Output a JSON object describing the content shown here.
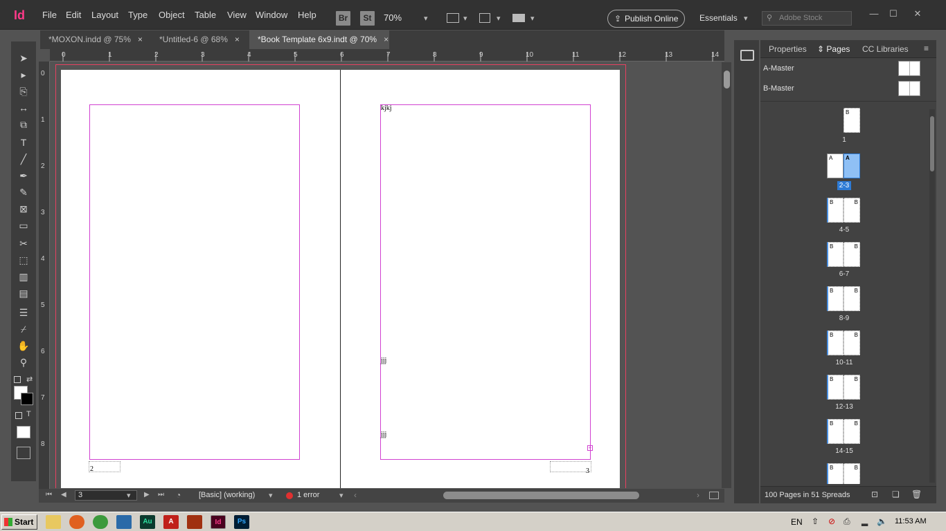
{
  "menubar": {
    "app_logo": "Id",
    "items": [
      "File",
      "Edit",
      "Layout",
      "Type",
      "Object",
      "Table",
      "View",
      "Window",
      "Help"
    ],
    "bridge_label": "Br",
    "stock_label": "St",
    "zoom": "70%",
    "publish_label": "Publish Online",
    "workspace": "Essentials",
    "search_placeholder": "Adobe Stock"
  },
  "tabs": [
    {
      "label": "*MOXON.indd @ 75%",
      "close": "×"
    },
    {
      "label": "*Untitled-6 @ 68%",
      "close": "×"
    },
    {
      "label": "*Book Template 6x9.indt @ 70%",
      "close": "×"
    }
  ],
  "ruler": {
    "top": [
      "0",
      "1",
      "2",
      "3",
      "4",
      "5",
      "6",
      "7",
      "8",
      "9",
      "10",
      "11",
      "12",
      "13",
      "14"
    ],
    "left": [
      "0",
      "1",
      "2",
      "3",
      "4",
      "5",
      "6",
      "7",
      "8"
    ]
  },
  "document": {
    "right_page_text1": "kjkj",
    "right_page_text2": "jjj",
    "right_page_text3": "jjj",
    "left_page_number": "2",
    "right_page_number": "3"
  },
  "status": {
    "page_number": "3",
    "preflight_profile": "[Basic] (working)",
    "errors": "1 error"
  },
  "panel": {
    "tabs": [
      "Properties",
      "Pages",
      "CC Libraries"
    ],
    "masters": [
      "A-Master",
      "B-Master"
    ],
    "spreads": [
      {
        "label": "1",
        "left": "",
        "right": "B"
      },
      {
        "label": "2-3",
        "left": "A",
        "right": "A"
      },
      {
        "label": "4-5",
        "left": "B",
        "right": "B"
      },
      {
        "label": "6-7",
        "left": "B",
        "right": "B"
      },
      {
        "label": "8-9",
        "left": "B",
        "right": "B"
      },
      {
        "label": "10-11",
        "left": "B",
        "right": "B"
      },
      {
        "label": "12-13",
        "left": "B",
        "right": "B"
      },
      {
        "label": "14-15",
        "left": "B",
        "right": "B"
      },
      {
        "label": "",
        "left": "B",
        "right": "B"
      }
    ],
    "footer": "100 Pages in 51 Spreads"
  },
  "taskbar": {
    "start": "Start",
    "apps": [
      "Au",
      "Id",
      "Ps"
    ],
    "language": "EN",
    "clock": "11:53 AM"
  },
  "colors": {
    "accent": "#2d7bd6",
    "indesign": "#ff3a8a",
    "margin_guides": "#d040d0",
    "bleed": "#e84060",
    "error": "#e03030"
  }
}
